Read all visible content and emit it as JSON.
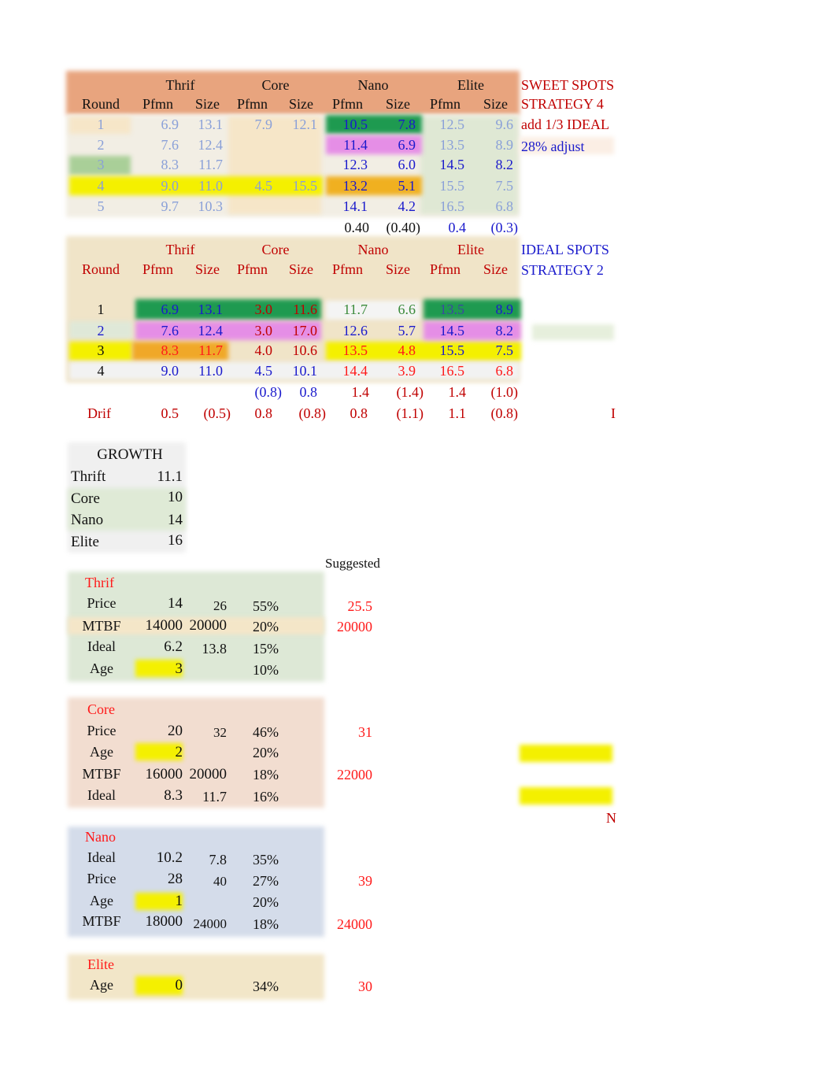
{
  "sweet_spots": {
    "group_headers": [
      "Thrif",
      "Core",
      "Nano",
      "Elite"
    ],
    "col_headers": [
      "Round",
      "Pfmn",
      "Size",
      "Pfmn",
      "Size",
      "Pfmn",
      "Size",
      "Pfmn",
      "Size"
    ],
    "rows": [
      {
        "round": "1",
        "thrif_pfmn": "6.9",
        "thrif_size": "13.1",
        "core_pfmn": "7.9",
        "core_size": "12.1",
        "nano_pfmn": "10.5",
        "nano_size": "7.8",
        "elite_pfmn": "12.5",
        "elite_size": "9.6"
      },
      {
        "round": "2",
        "thrif_pfmn": "7.6",
        "thrif_size": "12.4",
        "core_pfmn": "",
        "core_size": "",
        "nano_pfmn": "11.4",
        "nano_size": "6.9",
        "elite_pfmn": "13.5",
        "elite_size": "8.9"
      },
      {
        "round": "3",
        "thrif_pfmn": "8.3",
        "thrif_size": "11.7",
        "core_pfmn": "",
        "core_size": "",
        "nano_pfmn": "12.3",
        "nano_size": "6.0",
        "elite_pfmn": "14.5",
        "elite_size": "8.2"
      },
      {
        "round": "4",
        "thrif_pfmn": "9.0",
        "thrif_size": "11.0",
        "core_pfmn": "4.5",
        "core_size": "15.5",
        "nano_pfmn": "13.2",
        "nano_size": "5.1",
        "elite_pfmn": "15.5",
        "elite_size": "7.5"
      },
      {
        "round": "5",
        "thrif_pfmn": "9.7",
        "thrif_size": "10.3",
        "core_pfmn": "",
        "core_size": "",
        "nano_pfmn": "14.1",
        "nano_size": "4.2",
        "elite_pfmn": "16.5",
        "elite_size": "6.8"
      }
    ],
    "totals": {
      "nano_pfmn": "0.40",
      "nano_size": "(0.40)",
      "elite_pfmn": "0.4",
      "elite_size": "(0.3)"
    },
    "notes": [
      "SWEET SPOTS",
      "STRATEGY 4",
      "add 1/3 IDEAL",
      "28% adjust"
    ]
  },
  "ideal_spots": {
    "group_headers": [
      "Thrif",
      "Core",
      "Nano",
      "Elite"
    ],
    "col_headers": [
      "Round",
      "Pfmn",
      "Size",
      "Pfmn",
      "Size",
      "Pfmn",
      "Size",
      "Pfmn",
      "Size"
    ],
    "rows": [
      {
        "round": "1",
        "thrif_pfmn": "6.9",
        "thrif_size": "13.1",
        "core_pfmn": "3.0",
        "core_size": "11.6",
        "nano_pfmn": "11.7",
        "nano_size": "6.6",
        "elite_pfmn": "13.5",
        "elite_size": "8.9"
      },
      {
        "round": "2",
        "thrif_pfmn": "7.6",
        "thrif_size": "12.4",
        "core_pfmn": "3.0",
        "core_size": "17.0",
        "nano_pfmn": "12.6",
        "nano_size": "5.7",
        "elite_pfmn": "14.5",
        "elite_size": "8.2"
      },
      {
        "round": "3",
        "thrif_pfmn": "8.3",
        "thrif_size": "11.7",
        "core_pfmn": "4.0",
        "core_size": "10.6",
        "nano_pfmn": "13.5",
        "nano_size": "4.8",
        "elite_pfmn": "15.5",
        "elite_size": "7.5"
      },
      {
        "round": "4",
        "thrif_pfmn": "9.0",
        "thrif_size": "11.0",
        "core_pfmn": "4.5",
        "core_size": "10.1",
        "nano_pfmn": "14.4",
        "nano_size": "3.9",
        "elite_pfmn": "16.5",
        "elite_size": "6.8"
      }
    ],
    "totals": {
      "core_pfmn": "(0.8)",
      "core_size": "0.8",
      "nano_pfmn": "1.4",
      "nano_size": "(1.4)",
      "elite_pfmn": "1.4",
      "elite_size": "(1.0)"
    },
    "drif": {
      "label": "Drif",
      "thrif_pfmn": "0.5",
      "thrif_size": "(0.5)",
      "core_pfmn": "0.8",
      "core_size": "(0.8)",
      "nano_pfmn": "0.8",
      "nano_size": "(1.1)",
      "elite_pfmn": "1.1",
      "elite_size": "(0.8)"
    },
    "notes": [
      "IDEAL SPOTS",
      "STRATEGY 2"
    ],
    "edge_letter": "I"
  },
  "growth": {
    "title": "GROWTH",
    "rows": [
      {
        "label": "Thrift",
        "value": "11.1"
      },
      {
        "label": "Core",
        "value": "10"
      },
      {
        "label": "Nano",
        "value": "14"
      },
      {
        "label": "Elite",
        "value": "16"
      }
    ]
  },
  "suggested_label": "Suggested",
  "segments": [
    {
      "name": "Thrif",
      "rows": [
        {
          "label": "Price",
          "a": "14",
          "b": "26",
          "pct": "55%",
          "suggested": "25.5"
        },
        {
          "label": "MTBF",
          "a": "14000",
          "b": "20000",
          "pct": "20%",
          "suggested": "20000"
        },
        {
          "label": "Ideal",
          "a": "6.2",
          "b": "13.8",
          "pct": "15%",
          "suggested": ""
        },
        {
          "label": "Age",
          "a": "3",
          "b": "",
          "pct": "10%",
          "suggested": ""
        }
      ]
    },
    {
      "name": "Core",
      "rows": [
        {
          "label": "Price",
          "a": "20",
          "b": "32",
          "pct": "46%",
          "suggested": "31"
        },
        {
          "label": "Age",
          "a": "2",
          "b": "",
          "pct": "20%",
          "suggested": ""
        },
        {
          "label": "MTBF",
          "a": "16000",
          "b": "20000",
          "pct": "18%",
          "suggested": "22000"
        },
        {
          "label": "Ideal",
          "a": "8.3",
          "b": "11.7",
          "pct": "16%",
          "suggested": ""
        }
      ]
    },
    {
      "name": "Nano",
      "rows": [
        {
          "label": "Ideal",
          "a": "10.2",
          "b": "7.8",
          "pct": "35%",
          "suggested": ""
        },
        {
          "label": "Price",
          "a": "28",
          "b": "40",
          "pct": "27%",
          "suggested": "39"
        },
        {
          "label": "Age",
          "a": "1",
          "b": "",
          "pct": "20%",
          "suggested": ""
        },
        {
          "label": "MTBF",
          "a": "18000",
          "b": "24000",
          "pct": "18%",
          "suggested": "24000"
        }
      ]
    },
    {
      "name": "Elite",
      "rows": [
        {
          "label": "Age",
          "a": "0",
          "b": "",
          "pct": "34%",
          "suggested": "30"
        }
      ]
    }
  ],
  "edge_letter_n": "N"
}
